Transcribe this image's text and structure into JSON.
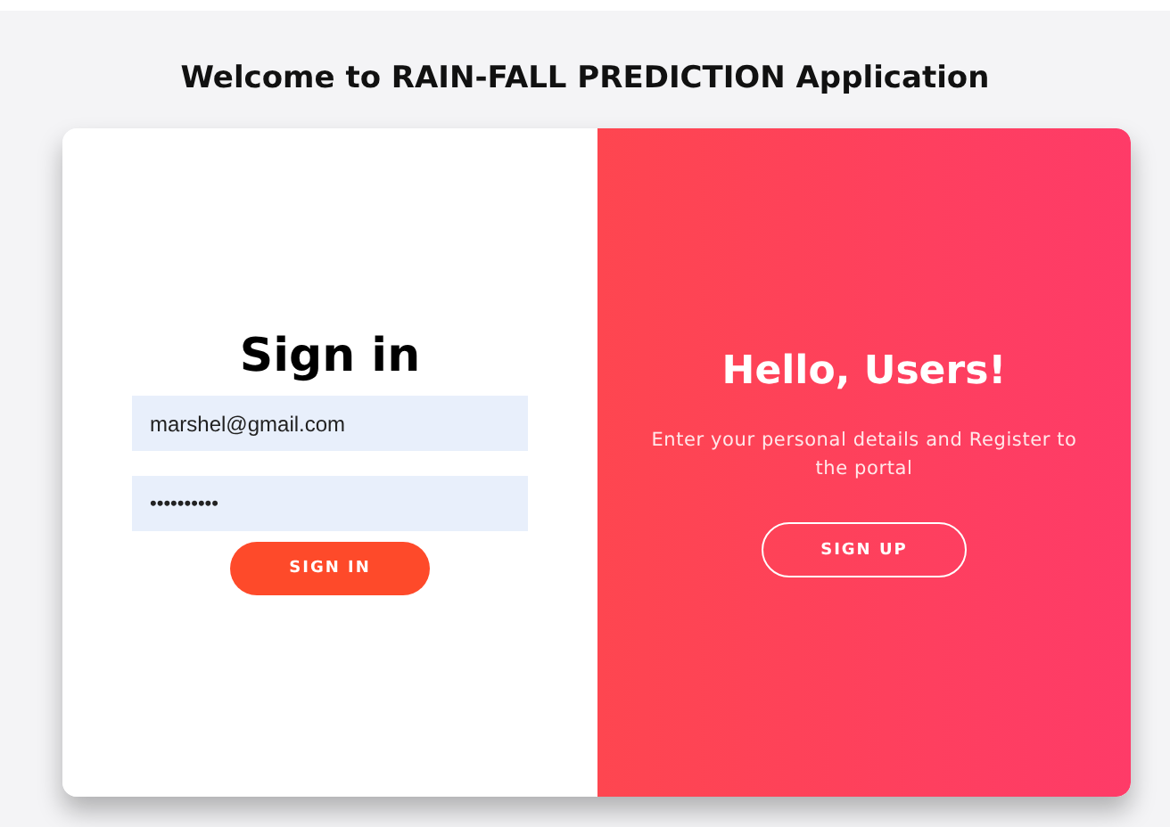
{
  "page_title": "Welcome to RAIN-FALL PREDICTION Application",
  "sign_in": {
    "heading": "Sign in",
    "email": {
      "value": "marshel@gmail.com"
    },
    "password": {
      "value": "••••••••••"
    },
    "button": "SIGN IN"
  },
  "sign_up_panel": {
    "heading": "Hello, Users!",
    "message": "Enter your personal details and Register to the portal",
    "button": "SIGN UP"
  }
}
